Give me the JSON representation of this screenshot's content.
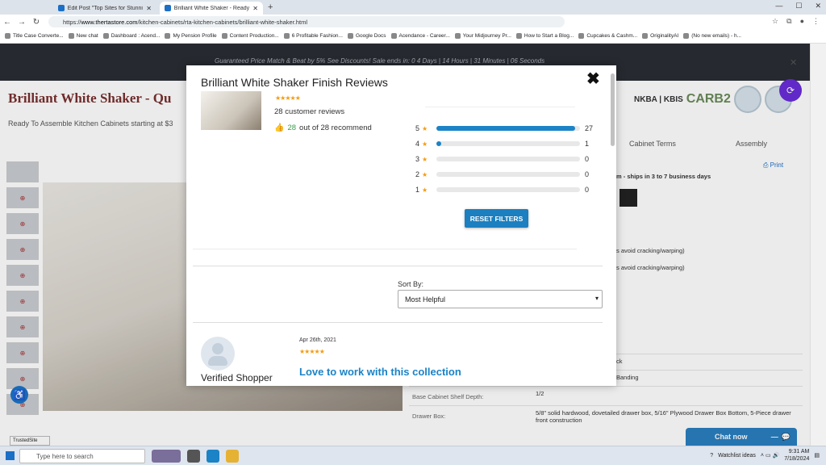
{
  "browser": {
    "tabs": [
      {
        "label": "Edit Post \"Top Sites for Stunning",
        "active": false
      },
      {
        "label": "Brilliant White Shaker - Ready To",
        "active": true
      }
    ],
    "url_prefix": "https://",
    "url_domain": "www.thertastore.com",
    "url_path": "/kitchen-cabinets/rta-kitchen-cabinets/brilliant-white-shaker.html",
    "bookmarks": [
      "Title Case Converte...",
      "New chat",
      "Dashboard : Acend...",
      "My Pension Profile",
      "Content Production...",
      "6 Profitable Fashion...",
      "Google Docs",
      "Acendance - Career...",
      "Your Midjourney Pr...",
      "How to Start a Blog...",
      "Cupcakes & Cashm...",
      "OriginalityAI",
      "(No new emails) - h..."
    ]
  },
  "page": {
    "banner_text": "Guaranteed Price Match  & Beat by 5%  See Discounts!   Sale ends in: 0 4 Days | 14 Hours | 31 Minutes | 06 Seconds",
    "title": "Brilliant White Shaker - Qu",
    "subtitle": "Ready To Assemble Kitchen Cabinets starting at $3",
    "logos": {
      "nkba": "NKBA | KBIS",
      "carb": "CARB2"
    },
    "tabs": [
      "Cabinet Terms",
      "Assembly"
    ],
    "print": "Print",
    "ship_text": "m - ships in 3 to 7 business days",
    "warp1": "s avoid cracking/warping)",
    "warp2": "s avoid cracking/warping)",
    "specs": [
      {
        "key": "",
        "value": "ck"
      },
      {
        "key": "",
        "value": "Banding"
      },
      {
        "key": "Base Cabinet Shelf Depth:",
        "value": "1/2"
      },
      {
        "key": "Drawer Box:",
        "value": "5/8\" solid hardwood, dovetailed drawer box, 5/16\" Plywood Drawer Box Bottom, 5-Piece drawer front construction"
      }
    ],
    "trusted": "TrustedSite",
    "chat": "Chat now"
  },
  "modal": {
    "title": "Brilliant White Shaker Finish Reviews",
    "stars": "★★★★★",
    "review_count": "28 customer reviews",
    "recommend_num": "28",
    "recommend_text": "out of 28 recommend",
    "reset": "RESET FILTERS",
    "sort_label": "Sort By:",
    "sort_value": "Most Helpful",
    "review": {
      "author": "Verified Shopper",
      "date": "Apr 26th, 2021",
      "stars": "★★★★★",
      "title": "Love to work with this collection"
    }
  },
  "chart_data": {
    "type": "bar",
    "categories": [
      "5",
      "4",
      "3",
      "2",
      "1"
    ],
    "values": [
      27,
      1,
      0,
      0,
      0
    ],
    "title": "",
    "xlabel": "",
    "ylabel": "",
    "ylim": [
      0,
      28
    ]
  },
  "taskbar": {
    "search_placeholder": "Type here to search",
    "weather": "Watchlist ideas",
    "time": "9:31 AM",
    "date": "7/18/2024"
  },
  "colors": {
    "accent": "#1b83c6",
    "star": "#f39c12",
    "green": "#37a047"
  }
}
